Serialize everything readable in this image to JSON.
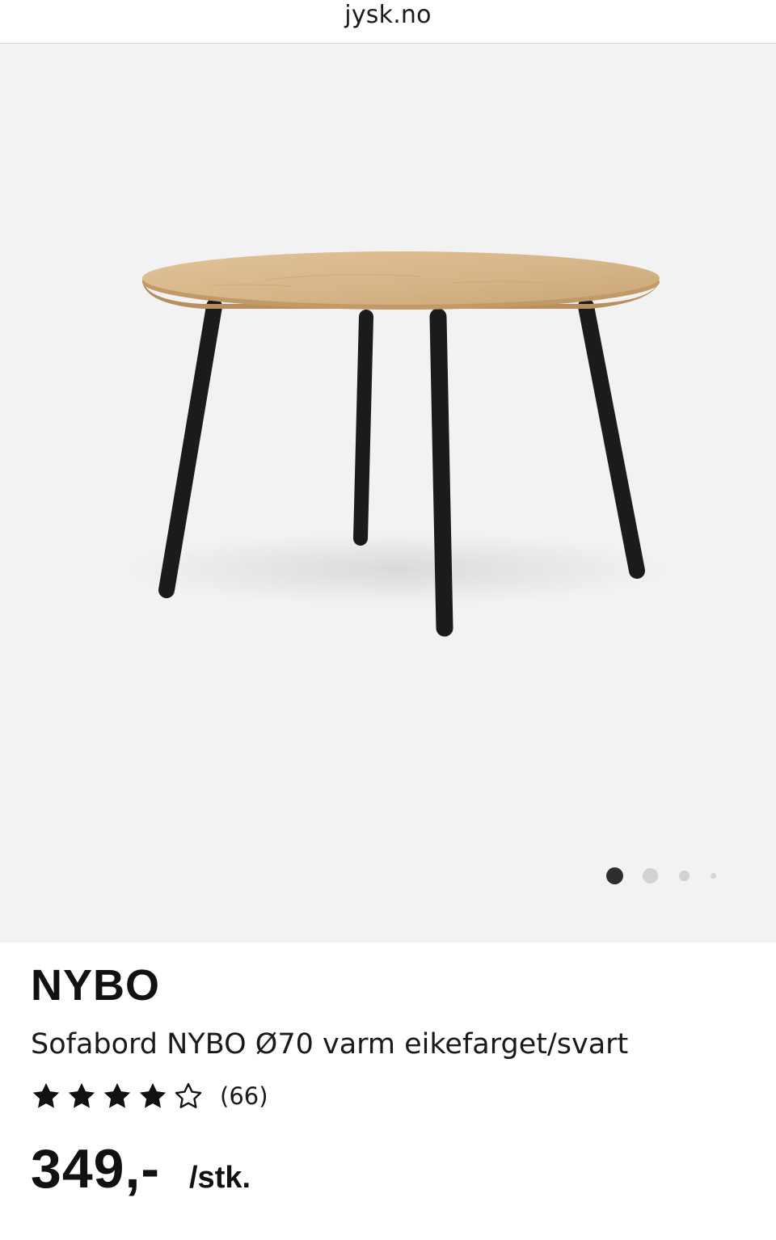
{
  "browser": {
    "url": "jysk.no"
  },
  "gallery": {
    "image_alt": "Sofabord NYBO Ø70 varm eikefarget/svart",
    "image_count": 4,
    "active_index": 1
  },
  "product": {
    "brand": "NYBO",
    "name": "Sofabord NYBO Ø70 varm eikefarget/svart",
    "rating": 4,
    "rating_max": 5,
    "review_count": "(66)",
    "price": "349,-",
    "price_unit": "/stk."
  },
  "colors": {
    "gallery_background": "#f3f2f3",
    "tabletop": "#d3b083",
    "legs": "#1b1b1b",
    "active_dot": "#2e2e2e",
    "inactive_dot": "#d2d2d2"
  }
}
